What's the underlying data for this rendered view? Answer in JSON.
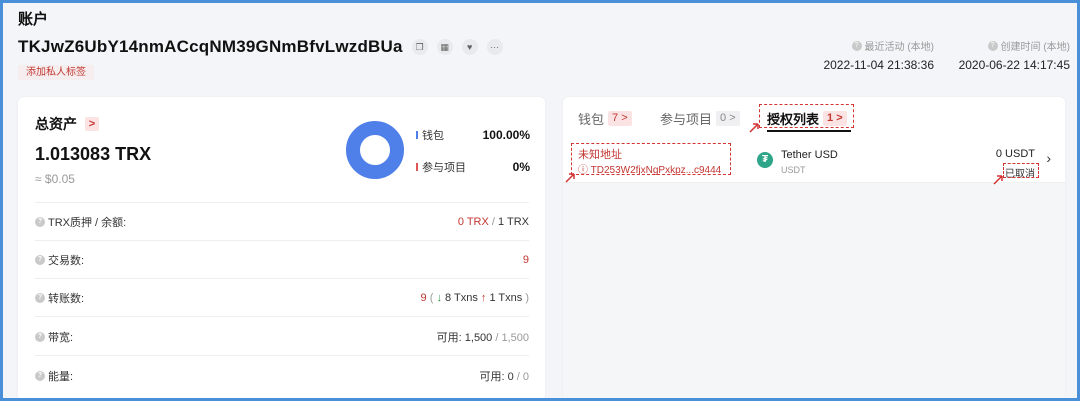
{
  "page": {
    "title": "账户"
  },
  "account": {
    "address": "TKJwZ6UbY14nmACcqNM39GNmBfvLwzdBUa",
    "tag_button": "添加私人标签",
    "icons": [
      "copy-icon",
      "qrcode-icon",
      "heart-icon",
      "more-icon"
    ]
  },
  "meta": {
    "last_active_label": "最近活动 (本地)",
    "last_active_value": "2022-11-04 21:38:36",
    "created_label": "创建时间 (本地)",
    "created_value": "2020-06-22 14:17:45"
  },
  "assets": {
    "title": "总资产",
    "arrow": ">",
    "amount": "1.013083 TRX",
    "usd": "≈ $0.05",
    "legend": [
      {
        "name": "钱包",
        "value": "100.00%",
        "color": "#4f7fe8",
        "fraction": 1.0
      },
      {
        "name": "参与项目",
        "value": "0%",
        "color": "#e05555",
        "fraction": 0.0
      }
    ]
  },
  "stats": [
    {
      "label": "TRX质押 / 余额:",
      "value_main": "0 TRX",
      "value_sep": " / ",
      "value_rest": "1 TRX"
    },
    {
      "label": "交易数:",
      "value_main": "9"
    },
    {
      "label": "转账数:",
      "value_main": "9",
      "in_count": "8 Txns",
      "out_count": "1 Txns"
    },
    {
      "label": "带宽:",
      "value_prefix": "可用: ",
      "value_used": "1,500",
      "value_sep": " / ",
      "value_total": "1,500"
    },
    {
      "label": "能量:",
      "value_prefix": "可用: ",
      "value_used": "0",
      "value_sep": " / ",
      "value_total": "0"
    }
  ],
  "tabs": [
    {
      "label": "钱包",
      "count": "7",
      "arrow": ">"
    },
    {
      "label": "参与项目",
      "count": "0",
      "arrow": ">"
    },
    {
      "label": "授权列表",
      "count": "1",
      "arrow": ">"
    }
  ],
  "approval": {
    "unknown_label": "未知地址",
    "unknown_address": "TD253W2fjxNgPxkpz...c9444",
    "token_name": "Tether USD",
    "token_symbol": "USDT",
    "amount": "0  USDT",
    "status": "已取消",
    "chevron": "›"
  },
  "colors": {
    "accent_red": "#c23631",
    "wallet_blue": "#4f7fe8",
    "annotation_red": "#d23434"
  }
}
